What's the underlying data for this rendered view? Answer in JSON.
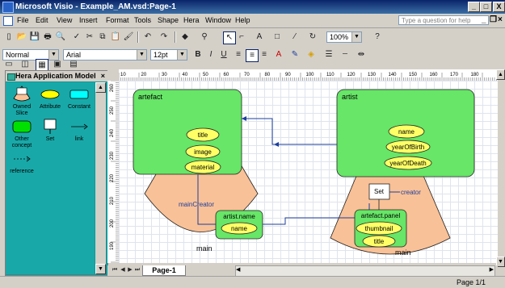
{
  "window": {
    "title": "Microsoft Visio - Example_AM.vsd:Page-1",
    "min": "_",
    "max": "□",
    "close": "X"
  },
  "menu": {
    "items": [
      "File",
      "Edit",
      "View",
      "Insert",
      "Format",
      "Tools",
      "Shape",
      "Hera",
      "Window",
      "Help"
    ],
    "ask_placeholder": "Type a question for help",
    "doc_min": "_",
    "doc_restore": "❐",
    "doc_close": "×"
  },
  "toolbar": {
    "zoom": "100%",
    "style": "Normal",
    "font": "Arial",
    "font_size": "12pt",
    "bold": "B",
    "italic": "I",
    "underline": "U"
  },
  "stencil": {
    "title": "Hera Application Model",
    "items": [
      {
        "label": "Owned Slice",
        "icon": "owned-slice-icon"
      },
      {
        "label": "Attribute",
        "icon": "attribute-icon"
      },
      {
        "label": "Constant",
        "icon": "constant-icon"
      },
      {
        "label": "Other concept",
        "icon": "other-concept-icon"
      },
      {
        "label": "Set",
        "icon": "set-icon"
      },
      {
        "label": "link",
        "icon": "link-icon"
      },
      {
        "label": "reference",
        "icon": "reference-icon"
      }
    ]
  },
  "ruler": {
    "h_ticks": [
      "10",
      "20",
      "30",
      "40",
      "50",
      "60",
      "70",
      "80",
      "90",
      "100",
      "110",
      "120",
      "130",
      "140",
      "150",
      "160",
      "170",
      "180"
    ],
    "v_ticks": [
      "260",
      "250",
      "240",
      "230",
      "220",
      "210",
      "200",
      "190"
    ]
  },
  "diagram": {
    "left_box_title": "artefact",
    "left_attrs": [
      "title",
      "image",
      "material"
    ],
    "main_creator_label": "mainCreator",
    "inner_left_title": "artist.name",
    "inner_left_attr": "name",
    "left_slice_label": "main",
    "right_box_title": "artist",
    "right_attrs": [
      "name",
      "yearOfBirth",
      "yearOfDeath"
    ],
    "set_label": "Set",
    "creator_label": "creator",
    "inner_right_title": "artefact.panel",
    "inner_right_attrs": [
      "thumbnail",
      "title"
    ],
    "right_slice_label": "main"
  },
  "tabs": {
    "page": "Page-1"
  },
  "status": {
    "page": "Page 1/1"
  },
  "colors": {
    "slice": "#f9c197",
    "box": "#67e667",
    "attribute": "#ffff66",
    "link": "#1c3f9e"
  }
}
